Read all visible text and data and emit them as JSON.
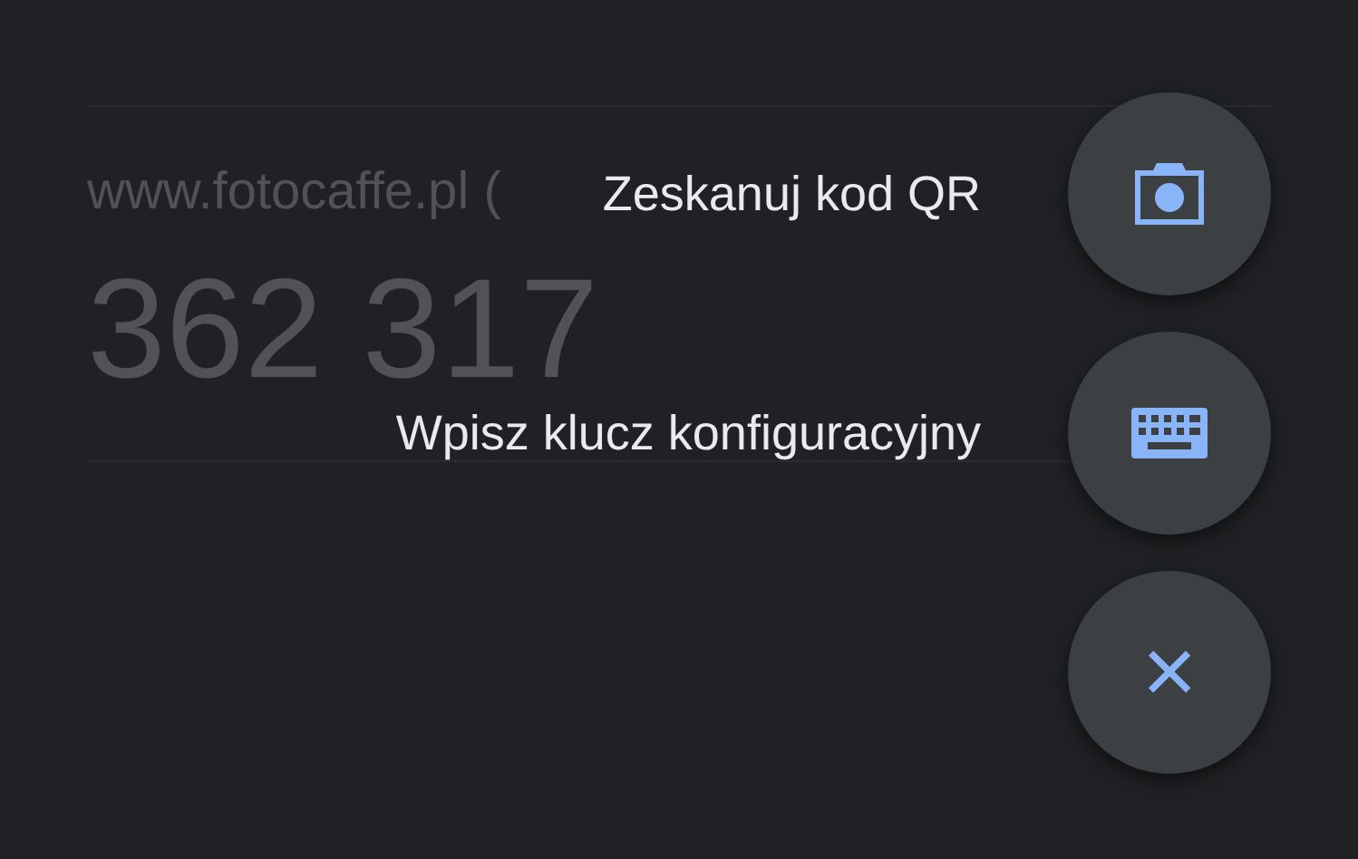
{
  "accounts": [
    {
      "issuer": "www.fotocaffe.pl (",
      "code": "362 317"
    }
  ],
  "fab_menu": {
    "actions": [
      {
        "label": "Zeskanuj kod QR",
        "kind": "camera"
      },
      {
        "label": "Wpisz klucz konfiguracyjny",
        "kind": "keyboard"
      }
    ],
    "close": {
      "label": "×"
    }
  }
}
